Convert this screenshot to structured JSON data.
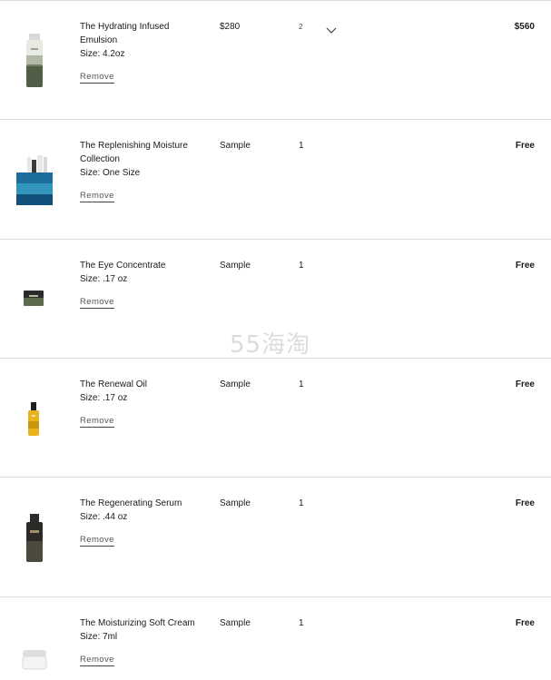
{
  "cart": {
    "items": [
      {
        "name": "The Hydrating Infused Emulsion",
        "size": "Size: 4.2oz",
        "price": "$280",
        "qty": "2",
        "total": "$560",
        "remove": "Remove"
      },
      {
        "name": "The Replenishing Moisture Collection",
        "size": "Size: One Size",
        "price": "Sample",
        "qty": "1",
        "total": "Free",
        "remove": "Remove"
      },
      {
        "name": "The Eye Concentrate",
        "size": "Size: .17 oz",
        "price": "Sample",
        "qty": "1",
        "total": "Free",
        "remove": "Remove"
      },
      {
        "name": "The Renewal Oil",
        "size": "Size: .17 oz",
        "price": "Sample",
        "qty": "1",
        "total": "Free",
        "remove": "Remove"
      },
      {
        "name": "The Regenerating Serum",
        "size": "Size: .44 oz",
        "price": "Sample",
        "qty": "1",
        "total": "Free",
        "remove": "Remove"
      },
      {
        "name": "The Moisturizing Soft Cream",
        "size": "Size: 7ml",
        "price": "Sample",
        "qty": "1",
        "total": "Free",
        "remove": "Remove"
      }
    ]
  },
  "watermark": "55海淘",
  "icons": {
    "qty_dropdown": "chevron-down-icon"
  }
}
